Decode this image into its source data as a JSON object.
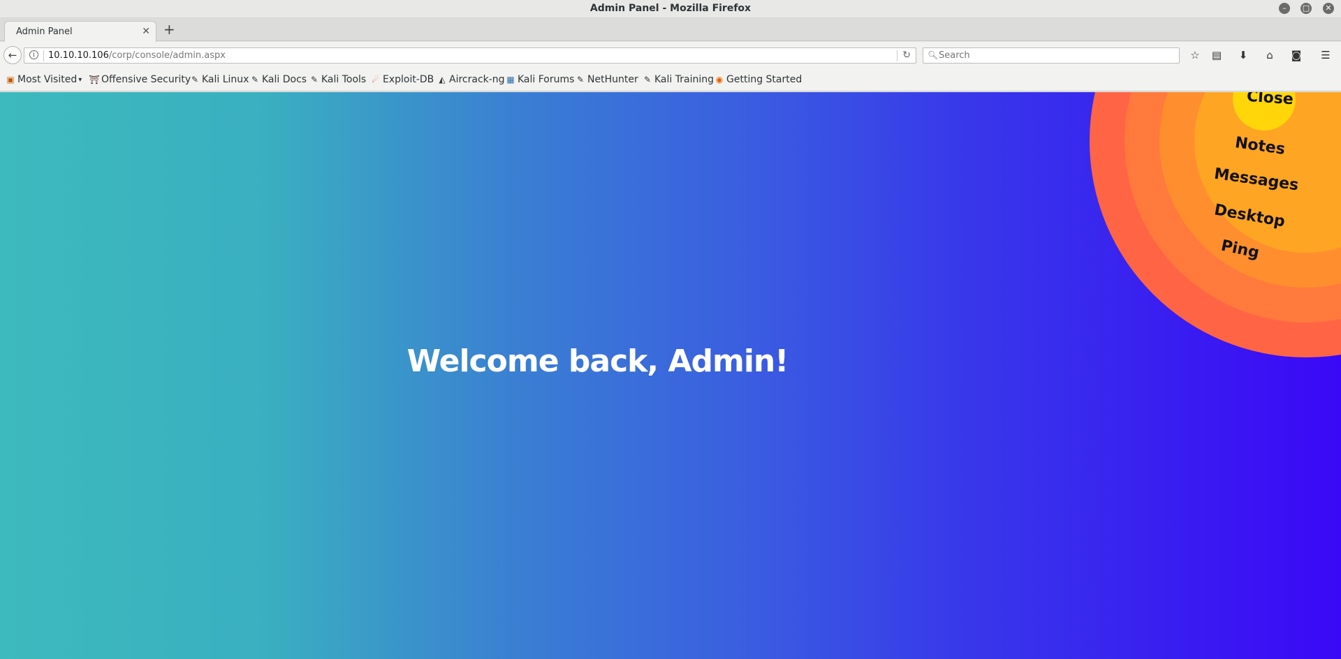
{
  "window": {
    "title": "Admin Panel - Mozilla Firefox",
    "minimize": "–",
    "maximize": "□",
    "close": "✕"
  },
  "tabs": [
    {
      "label": "Admin Panel",
      "close": "✕"
    }
  ],
  "newtab": "+",
  "nav": {
    "back": "←",
    "url_host": "10.10.10.106",
    "url_path": "/corp/console/admin.aspx",
    "reload": "↻",
    "search_placeholder": "Search",
    "icons": [
      "star-icon",
      "reading-list-icon",
      "download-icon",
      "home-icon",
      "pocket-icon",
      "menu-icon"
    ]
  },
  "bookmarks": [
    {
      "label": "Most Visited",
      "icon": "most-visited-icon"
    },
    {
      "label": "Offensive Security",
      "icon": "offsec-icon"
    },
    {
      "label": "Kali Linux",
      "icon": "kali-icon"
    },
    {
      "label": "Kali Docs",
      "icon": "kali-icon"
    },
    {
      "label": "Kali Tools",
      "icon": "kali-icon"
    },
    {
      "label": "Exploit-DB",
      "icon": "exploitdb-icon"
    },
    {
      "label": "Aircrack-ng",
      "icon": "aircrack-icon"
    },
    {
      "label": "Kali Forums",
      "icon": "forums-icon"
    },
    {
      "label": "NetHunter",
      "icon": "kali-icon"
    },
    {
      "label": "Kali Training",
      "icon": "kali-icon"
    },
    {
      "label": "Getting Started",
      "icon": "firefox-icon"
    }
  ],
  "page": {
    "welcome": "Welcome back, Admin!"
  },
  "menu": {
    "close": "Close",
    "notes": "Notes",
    "messages": "Messages",
    "desktop": "Desktop",
    "ping": "Ping"
  },
  "colors": {
    "gradient_left": "#3dbabd",
    "gradient_right": "#3a08f6",
    "ring_ping": "#ff6545",
    "ring_desktop": "#ff7a3c",
    "ring_messages": "#ff8f2e",
    "ring_notes": "#ffa524",
    "ring_close": "#ffd60a"
  }
}
